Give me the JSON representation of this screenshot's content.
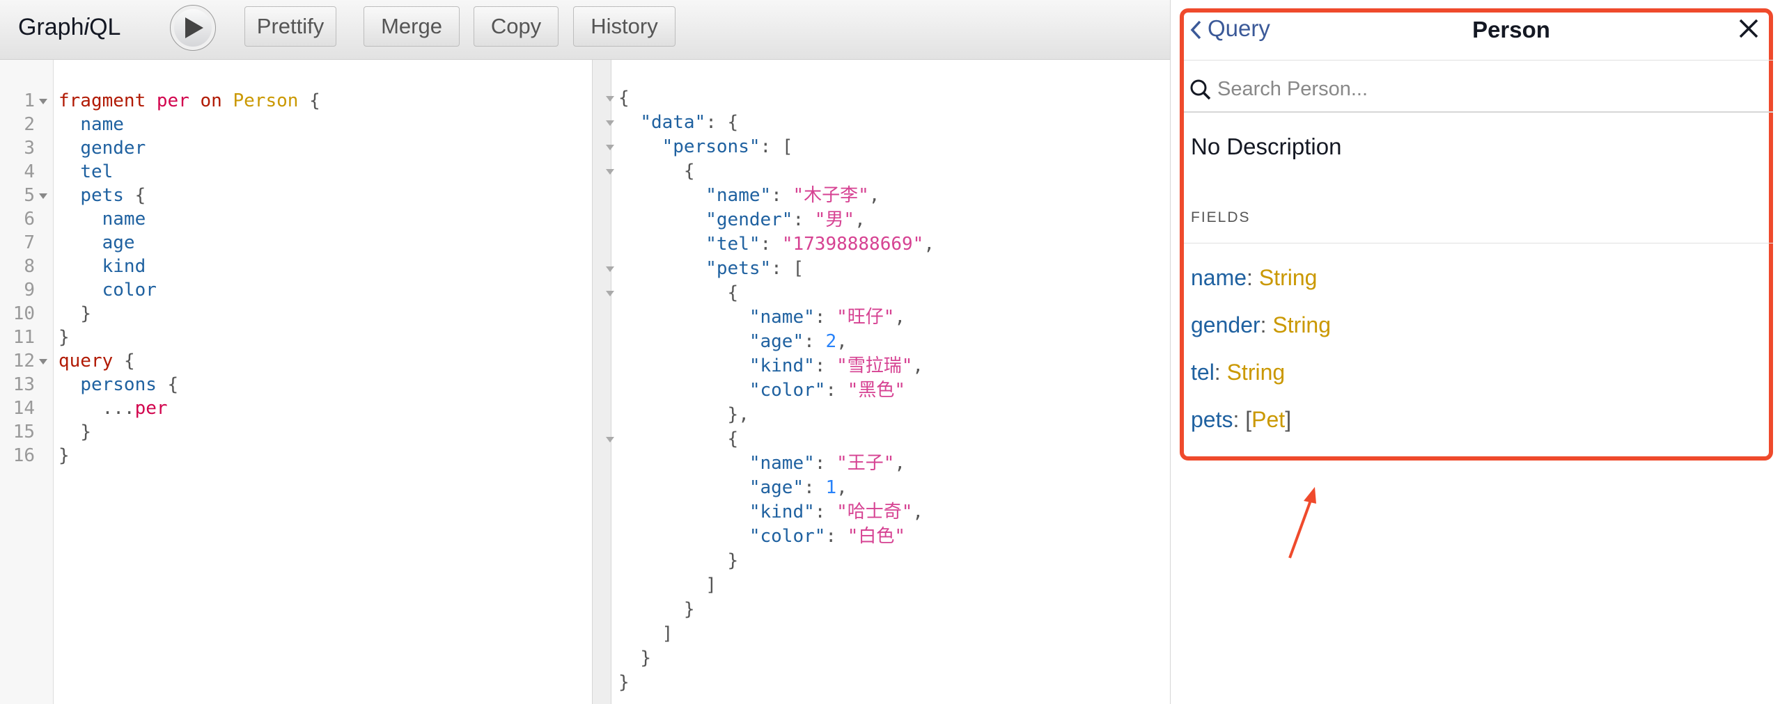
{
  "toolbar": {
    "title_pre": "Graph",
    "title_i": "i",
    "title_post": "QL",
    "buttons": [
      "Prettify",
      "Merge",
      "Copy",
      "History"
    ]
  },
  "editor": {
    "line_numbers": [
      "1",
      "2",
      "3",
      "4",
      "5",
      "6",
      "7",
      "8",
      "9",
      "10",
      "11",
      "12",
      "13",
      "14",
      "15",
      "16"
    ],
    "tokens": {
      "fragment": "fragment",
      "per": "per",
      "on": "on",
      "Person": "Person",
      "lbrace": "{",
      "rbrace": "}",
      "name": "name",
      "gender": "gender",
      "tel": "tel",
      "pets": "pets",
      "age": "age",
      "kind": "kind",
      "color": "color",
      "query": "query",
      "persons": "persons",
      "spread": "...",
      "spread_name": "per"
    }
  },
  "result": {
    "lines": [
      {
        "indent": 0,
        "punct_open": "{"
      },
      {
        "indent": 1,
        "key": "\"data\"",
        "punct_after": ": {"
      },
      {
        "indent": 2,
        "key": "\"persons\"",
        "punct_after": ": ["
      },
      {
        "indent": 3,
        "punct_open": "{"
      },
      {
        "indent": 4,
        "key": "\"name\"",
        "sep": ": ",
        "str": "\"木子李\"",
        "tail": ","
      },
      {
        "indent": 4,
        "key": "\"gender\"",
        "sep": ": ",
        "str": "\"男\"",
        "tail": ","
      },
      {
        "indent": 4,
        "key": "\"tel\"",
        "sep": ": ",
        "str": "\"17398888669\"",
        "tail": ","
      },
      {
        "indent": 4,
        "key": "\"pets\"",
        "punct_after": ": ["
      },
      {
        "indent": 5,
        "punct_open": "{"
      },
      {
        "indent": 6,
        "key": "\"name\"",
        "sep": ": ",
        "str": "\"旺仔\"",
        "tail": ","
      },
      {
        "indent": 6,
        "key": "\"age\"",
        "sep": ": ",
        "num": "2",
        "tail": ","
      },
      {
        "indent": 6,
        "key": "\"kind\"",
        "sep": ": ",
        "str": "\"雪拉瑞\"",
        "tail": ","
      },
      {
        "indent": 6,
        "key": "\"color\"",
        "sep": ": ",
        "str": "\"黑色\"",
        "tail": ""
      },
      {
        "indent": 5,
        "punct_open": "},"
      },
      {
        "indent": 5,
        "punct_open": "{"
      },
      {
        "indent": 6,
        "key": "\"name\"",
        "sep": ": ",
        "str": "\"王子\"",
        "tail": ","
      },
      {
        "indent": 6,
        "key": "\"age\"",
        "sep": ": ",
        "num": "1",
        "tail": ","
      },
      {
        "indent": 6,
        "key": "\"kind\"",
        "sep": ": ",
        "str": "\"哈士奇\"",
        "tail": ","
      },
      {
        "indent": 6,
        "key": "\"color\"",
        "sep": ": ",
        "str": "\"白色\"",
        "tail": ""
      },
      {
        "indent": 5,
        "punct_open": "}"
      },
      {
        "indent": 4,
        "punct_open": "]"
      },
      {
        "indent": 3,
        "punct_open": "}"
      },
      {
        "indent": 2,
        "punct_open": "]"
      },
      {
        "indent": 1,
        "punct_open": "}"
      },
      {
        "indent": 0,
        "punct_open": "}"
      }
    ]
  },
  "docs": {
    "back_label": "Query",
    "title": "Person",
    "search_placeholder": "Search Person...",
    "description": "No Description",
    "fields_title": "FIELDS",
    "fields": [
      {
        "name": "name",
        "colon": ": ",
        "type": "String"
      },
      {
        "name": "gender",
        "colon": ": ",
        "type": "String"
      },
      {
        "name": "tel",
        "colon": ": ",
        "type": "String"
      },
      {
        "name": "pets",
        "colon": ": ",
        "lb": "[",
        "type": "Pet",
        "rb": "]"
      }
    ]
  },
  "colors": {
    "highlight": "#ef4a2c",
    "keyword": "#b11a04",
    "def": "#d2054e",
    "type": "#ca9800",
    "property": "#1f61a0",
    "string": "#d64292",
    "number": "#2882f9"
  }
}
